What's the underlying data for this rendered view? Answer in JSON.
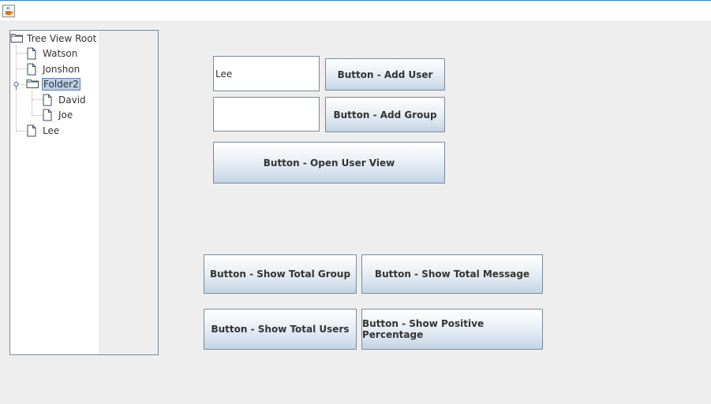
{
  "window": {
    "app_icon": "java-cup-icon"
  },
  "tree": {
    "root": {
      "label": "Tree View   Root",
      "icon": "folder-icon"
    },
    "items": [
      {
        "label": "Watson",
        "icon": "file-icon",
        "level": 1
      },
      {
        "label": "Jonshon",
        "icon": "file-icon",
        "level": 1
      },
      {
        "label": "Folder2",
        "icon": "folder-icon",
        "level": 1,
        "selected": true,
        "expanded": true
      },
      {
        "label": "David",
        "icon": "file-icon",
        "level": 2
      },
      {
        "label": "Joe",
        "icon": "file-icon",
        "level": 2
      },
      {
        "label": "Lee",
        "icon": "file-icon",
        "level": 1
      }
    ]
  },
  "form": {
    "user_field_value": "Lee",
    "group_field_value": "",
    "add_user_label": "Button - Add User",
    "add_group_label": "Button - Add Group",
    "open_user_view_label": "Button - Open User View"
  },
  "stats": {
    "show_total_group_label": "Button - Show Total Group",
    "show_total_message_label": "Button - Show Total Message",
    "show_total_users_label": "Button - Show Total Users",
    "show_positive_percentage_label": "Button - Show Positive Percentage"
  },
  "colors": {
    "background": "#eeeeee",
    "selection": "#b8cfe5",
    "border": "#7a8a99",
    "title_accent": "#3b7fc4"
  }
}
